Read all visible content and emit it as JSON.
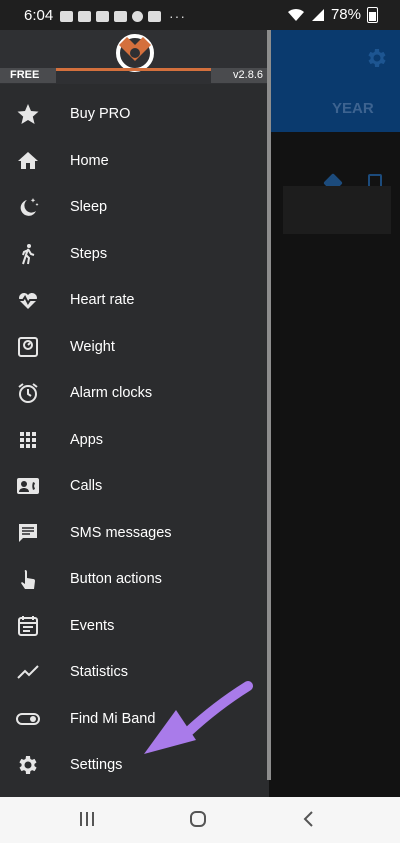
{
  "status_bar": {
    "time": "6:04",
    "battery": "78%"
  },
  "background_app": {
    "tab_year": "YEAR"
  },
  "drawer": {
    "badge_free": "FREE",
    "version": "v2.8.6",
    "items": [
      {
        "label": "Buy PRO",
        "icon": "star-icon"
      },
      {
        "label": "Home",
        "icon": "home-icon"
      },
      {
        "label": "Sleep",
        "icon": "sleep-icon"
      },
      {
        "label": "Steps",
        "icon": "walk-icon"
      },
      {
        "label": "Heart rate",
        "icon": "heart-rate-icon"
      },
      {
        "label": "Weight",
        "icon": "scale-icon"
      },
      {
        "label": "Alarm clocks",
        "icon": "alarm-icon"
      },
      {
        "label": "Apps",
        "icon": "apps-grid-icon"
      },
      {
        "label": "Calls",
        "icon": "contact-card-icon"
      },
      {
        "label": "SMS messages",
        "icon": "message-icon"
      },
      {
        "label": "Button actions",
        "icon": "touch-icon"
      },
      {
        "label": "Events",
        "icon": "event-icon"
      },
      {
        "label": "Statistics",
        "icon": "trending-icon"
      },
      {
        "label": "Find Mi Band",
        "icon": "toggle-icon"
      },
      {
        "label": "Settings",
        "icon": "gear-icon"
      }
    ]
  },
  "colors": {
    "drawer_bg": "#2b2c2e",
    "accent_orange": "#d4703d",
    "arrow_purple": "#a97bea",
    "header_blue": "#0a3a6e"
  }
}
